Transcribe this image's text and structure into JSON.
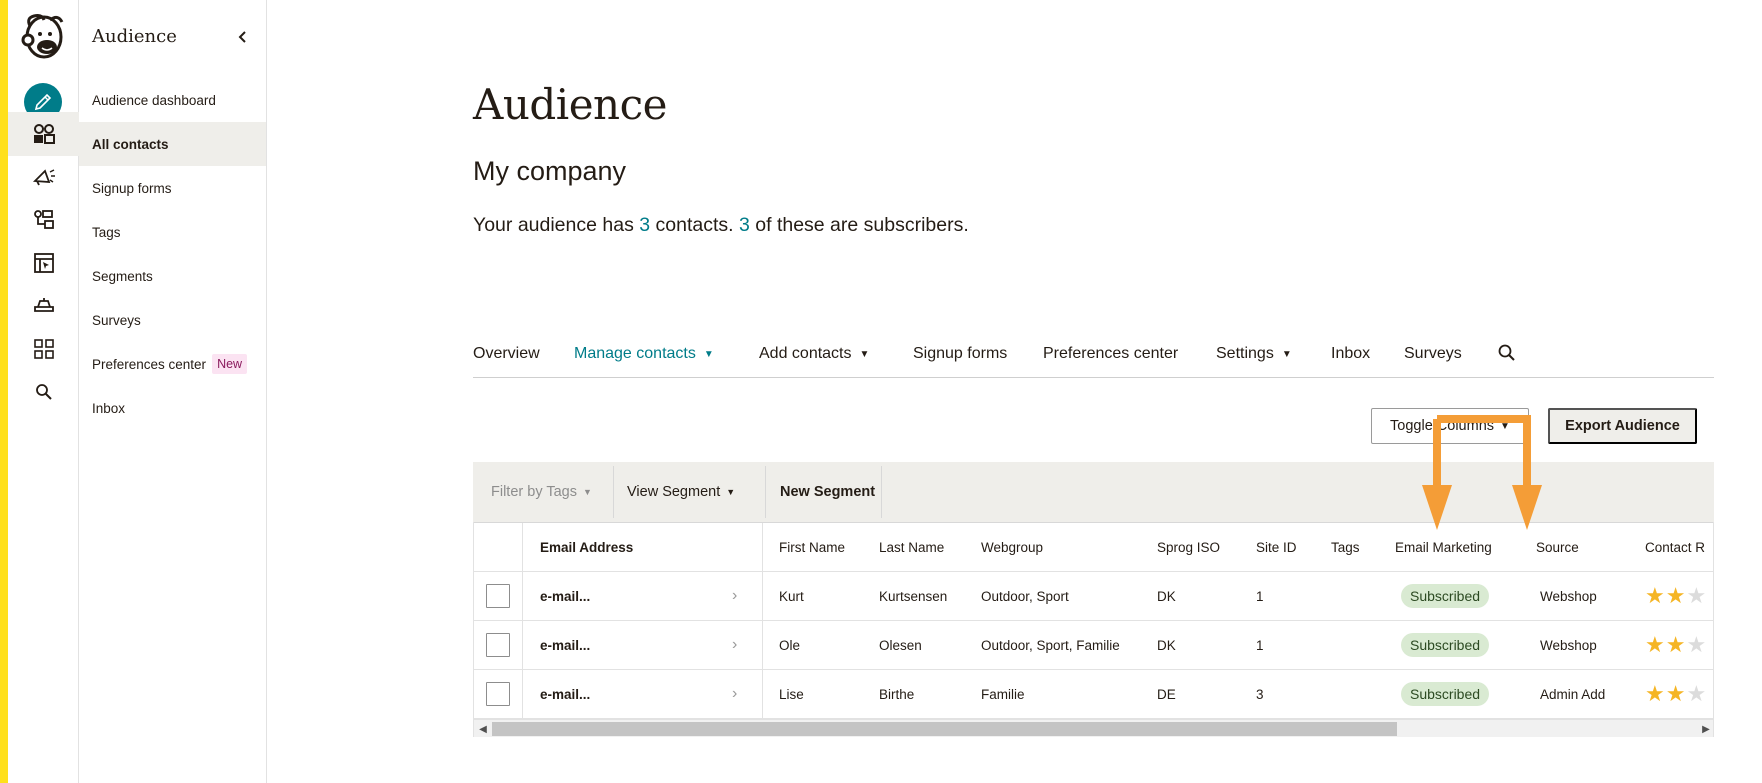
{
  "sidebar": {
    "title": "Audience",
    "items": [
      {
        "label": "Audience dashboard",
        "active": false
      },
      {
        "label": "All contacts",
        "active": true
      },
      {
        "label": "Signup forms",
        "active": false
      },
      {
        "label": "Tags",
        "active": false
      },
      {
        "label": "Segments",
        "active": false
      },
      {
        "label": "Surveys",
        "active": false
      },
      {
        "label": "Preferences center",
        "active": false,
        "badge": "New"
      },
      {
        "label": "Inbox",
        "active": false
      }
    ]
  },
  "rail": {
    "icons": [
      "mailchimp-logo",
      "create-pencil-icon",
      "audience-icon",
      "campaigns-megaphone-icon",
      "automations-icon",
      "website-icon",
      "integrations-icon",
      "apps-grid-icon",
      "search-icon"
    ]
  },
  "header": {
    "title": "Audience",
    "company": "My company",
    "summary": {
      "prefix": "Your audience has ",
      "contacts": "3",
      "middle": " contacts. ",
      "subscribers": "3",
      "suffix": " of these are subscribers."
    }
  },
  "tabs": [
    {
      "label": "Overview",
      "active": false,
      "dropdown": false
    },
    {
      "label": "Manage contacts",
      "active": true,
      "dropdown": true
    },
    {
      "label": "Add contacts",
      "active": false,
      "dropdown": true
    },
    {
      "label": "Signup forms",
      "active": false,
      "dropdown": false
    },
    {
      "label": "Preferences center",
      "active": false,
      "dropdown": false
    },
    {
      "label": "Settings",
      "active": false,
      "dropdown": true
    },
    {
      "label": "Inbox",
      "active": false,
      "dropdown": false
    },
    {
      "label": "Surveys",
      "active": false,
      "dropdown": false
    }
  ],
  "toolbar": {
    "toggle_columns": "Toggle Columns",
    "export": "Export Audience"
  },
  "filters": {
    "filter_by_tags": "Filter by Tags",
    "view_segment": "View Segment",
    "new_segment": "New Segment"
  },
  "table": {
    "columns": [
      "Email Address",
      "First Name",
      "Last Name",
      "Webgroup",
      "Sprog ISO",
      "Site ID",
      "Tags",
      "Email Marketing",
      "Source",
      "Contact R"
    ],
    "rows": [
      {
        "email": "e-mail...",
        "first": "Kurt",
        "last": "Kurtsensen",
        "webgroup": "Outdoor, Sport",
        "sprog": "DK",
        "site": "1",
        "tags": "",
        "marketing": "Subscribed",
        "source": "Webshop",
        "rating": 2
      },
      {
        "email": "e-mail...",
        "first": "Ole",
        "last": "Olesen",
        "webgroup": "Outdoor, Sport, Familie",
        "sprog": "DK",
        "site": "1",
        "tags": "",
        "marketing": "Subscribed",
        "source": "Webshop",
        "rating": 2
      },
      {
        "email": "e-mail...",
        "first": "Lise",
        "last": "Birthe",
        "webgroup": "Familie",
        "sprog": "DE",
        "site": "3",
        "tags": "",
        "marketing": "Subscribed",
        "source": "Admin Add",
        "rating": 2
      }
    ]
  },
  "colors": {
    "accent": "#007c89",
    "brand_yellow": "#ffe01b",
    "annotation_orange": "#f49d37",
    "subscribed_bg": "#d9ead2",
    "star": "#f5b524"
  }
}
